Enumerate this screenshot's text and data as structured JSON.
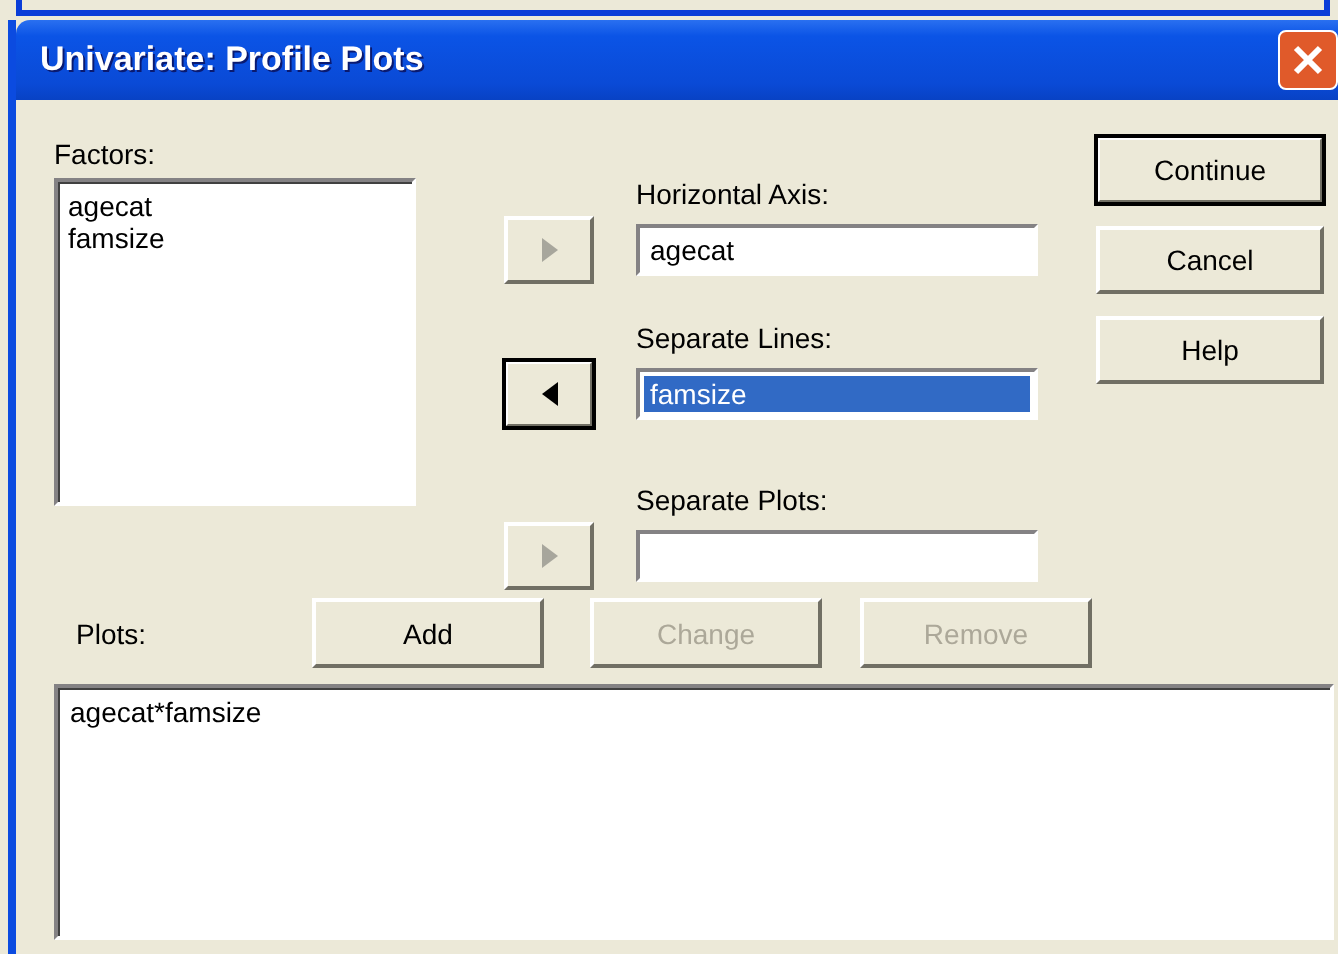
{
  "window": {
    "title": "Univariate: Profile Plots"
  },
  "factors": {
    "label": "Factors:",
    "items": [
      "agecat",
      "famsize"
    ]
  },
  "targets": [
    {
      "label": "Horizontal Axis:",
      "value": "agecat",
      "selected": false,
      "arrow": {
        "kind": "right",
        "disabled": true,
        "default": false
      }
    },
    {
      "label": "Separate Lines:",
      "value": "famsize",
      "selected": true,
      "arrow": {
        "kind": "left",
        "disabled": false,
        "default": true
      }
    },
    {
      "label": "Separate Plots:",
      "selected": false,
      "arrow": {
        "kind": "right",
        "disabled": true,
        "default": false
      }
    }
  ],
  "buttons": [
    {
      "label": "Continue",
      "default": true
    },
    {
      "label": "Cancel",
      "default": false
    },
    {
      "label": "Help",
      "default": false
    }
  ],
  "plots": {
    "label": "Plots:",
    "buttons": [
      {
        "label": "Add",
        "disabled": false
      },
      {
        "label": "Change",
        "disabled": true
      },
      {
        "label": "Remove",
        "disabled": true
      }
    ],
    "items": [
      "agecat*famsize"
    ]
  }
}
